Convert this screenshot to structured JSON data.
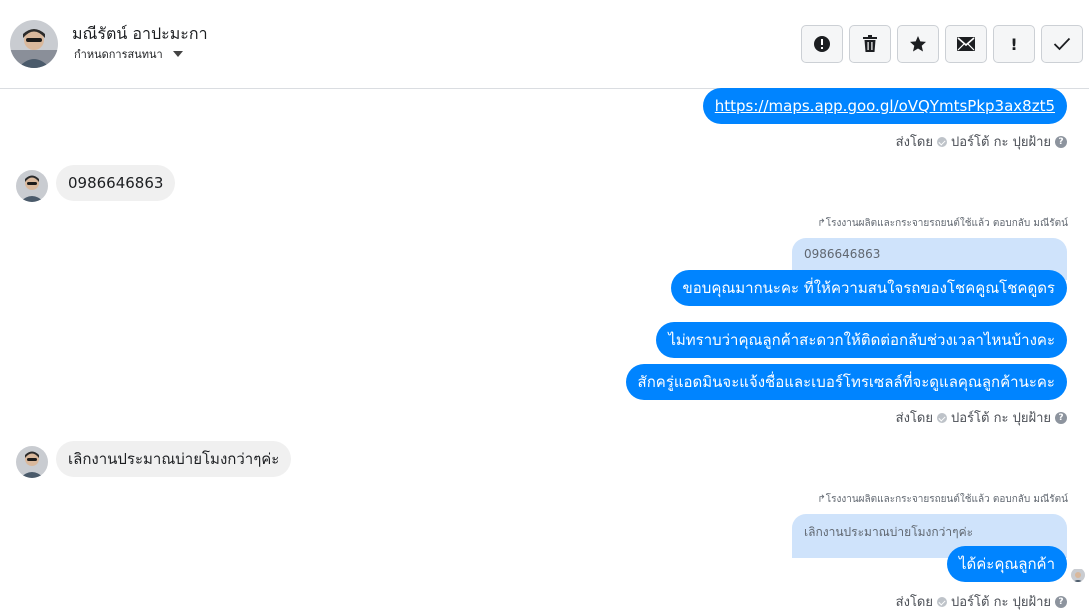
{
  "header": {
    "contact_name": "มณีรัตน์ อาปะมะกา",
    "assign_label": "กำหนดการสนทนา",
    "icons": [
      "alert-icon",
      "trash-icon",
      "star-icon",
      "mail-icon",
      "exclamation-icon",
      "check-icon"
    ],
    "exclamation_text": "!"
  },
  "colors": {
    "outgoing": "#0084ff",
    "incoming": "#f0f0f0",
    "quote": "#cfe3fb"
  },
  "messages": {
    "m1": {
      "text": "https://maps.app.goo.gl/oVQYmtsPkp3ax8zt5"
    },
    "s1": {
      "prefix": "ส่งโดย",
      "agent": "ปอร์โต้ กะ ปุยฝ้าย",
      "help": "?"
    },
    "in1": {
      "text": "0986646863"
    },
    "reply1": {
      "meta": "โรงงานผลิตและกระจายรถยนต์ใช้แล้ว ตอบกลับ มณีรัตน์",
      "quote": "0986646863"
    },
    "m2": {
      "text": "ขอบคุณมากนะคะ ที่ให้ความสนใจรถของโชคคูณโชคดูดร"
    },
    "m3": {
      "text": "ไม่ทราบว่าคุณลูกค้าสะดวกให้ติดต่อกลับช่วงเวลาไหนบ้างคะ"
    },
    "m4": {
      "text": "สักครู่แอดมินจะแจ้งชื่อและเบอร์โทรเซลล์ที่จะดูแลคุณลูกค้านะคะ"
    },
    "s2": {
      "prefix": "ส่งโดย",
      "agent": "ปอร์โต้ กะ ปุยฝ้าย",
      "help": "?"
    },
    "in2": {
      "text": "เลิกงานประมาณบ่ายโมงกว่าๆค่ะ"
    },
    "reply2": {
      "meta": "โรงงานผลิตและกระจายรถยนต์ใช้แล้ว ตอบกลับ มณีรัตน์",
      "quote": "เลิกงานประมาณบ่ายโมงกว่าๆค่ะ"
    },
    "m5": {
      "text": "ได้ค่ะคุณลูกค้า"
    },
    "s3": {
      "prefix": "ส่งโดย",
      "agent": "ปอร์โต้ กะ ปุยฝ้าย",
      "help": "?"
    }
  }
}
